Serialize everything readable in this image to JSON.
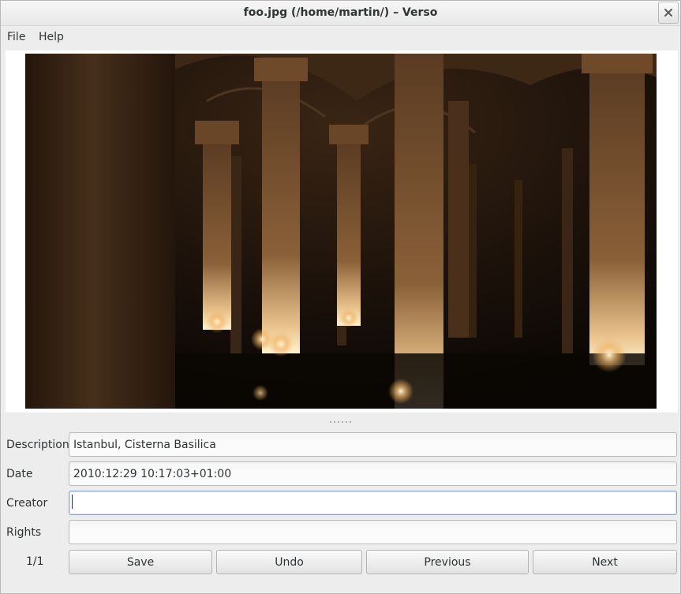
{
  "window": {
    "title": "foo.jpg (/home/martin/) – Verso"
  },
  "menu": {
    "file": "File",
    "help": "Help"
  },
  "image": {
    "subject": "Istanbul cistern columns photo"
  },
  "fields": {
    "description": {
      "label": "Description",
      "value": "Istanbul, Cisterna Basilica"
    },
    "date": {
      "label": "Date",
      "value": "2010:12:29 10:17:03+01:00"
    },
    "creator": {
      "label": "Creator",
      "value": ""
    },
    "rights": {
      "label": "Rights",
      "value": ""
    }
  },
  "footer": {
    "counter": "1/1",
    "save": "Save",
    "undo": "Undo",
    "previous": "Previous",
    "next": "Next"
  },
  "icons": {
    "close": "close-icon"
  },
  "colors": {
    "window_bg": "#ededed",
    "focus_border": "#8fa5c2"
  }
}
